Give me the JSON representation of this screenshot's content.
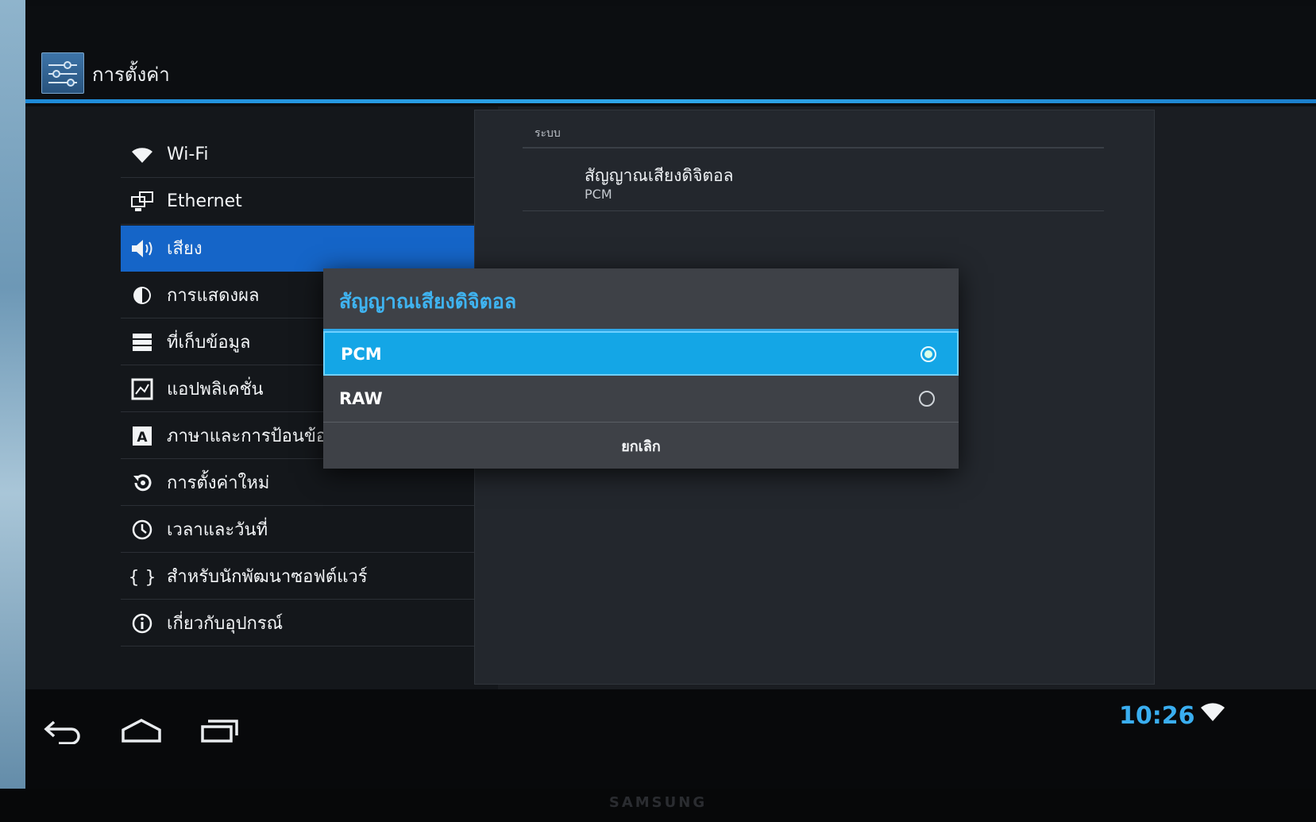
{
  "app": {
    "title": "การตั้งค่า"
  },
  "nav": {
    "items": [
      {
        "label": "Wi-Fi",
        "icon": "wifi-icon"
      },
      {
        "label": "Ethernet",
        "icon": "ethernet-icon"
      },
      {
        "label": "เสียง",
        "icon": "speaker-icon",
        "selected": true
      },
      {
        "label": "การแสดงผล",
        "icon": "brightness-icon"
      },
      {
        "label": "ที่เก็บข้อมูล",
        "icon": "storage-icon"
      },
      {
        "label": "แอปพลิเคชั่น",
        "icon": "apps-icon"
      },
      {
        "label": "ภาษาและการป้อนข้อ",
        "icon": "language-icon"
      },
      {
        "label": "การตั้งค่าใหม่",
        "icon": "reset-icon"
      },
      {
        "label": "เวลาและวันที่",
        "icon": "clock-icon"
      },
      {
        "label": "สำหรับนักพัฒนาซอฟต์แวร์",
        "icon": "developer-braces-icon"
      },
      {
        "label": "เกี่ยวกับอุปกรณ์",
        "icon": "info-icon"
      }
    ]
  },
  "pane": {
    "section_header": "ระบบ",
    "pref_title": "สัญญาณเสียงดิจิตอล",
    "pref_summary": "PCM"
  },
  "dialog": {
    "title": "สัญญาณเสียงดิจิตอล",
    "options": [
      {
        "label": "PCM",
        "checked": true
      },
      {
        "label": "RAW",
        "checked": false
      }
    ],
    "cancel_label": "ยกเลิก"
  },
  "status": {
    "time": "10:26"
  },
  "bezel": {
    "brand": "SAMSUNG"
  },
  "colors": {
    "accent": "#2fa8ea",
    "nav_selected": "#1565c8",
    "dialog_selected": "#14a6e6"
  }
}
